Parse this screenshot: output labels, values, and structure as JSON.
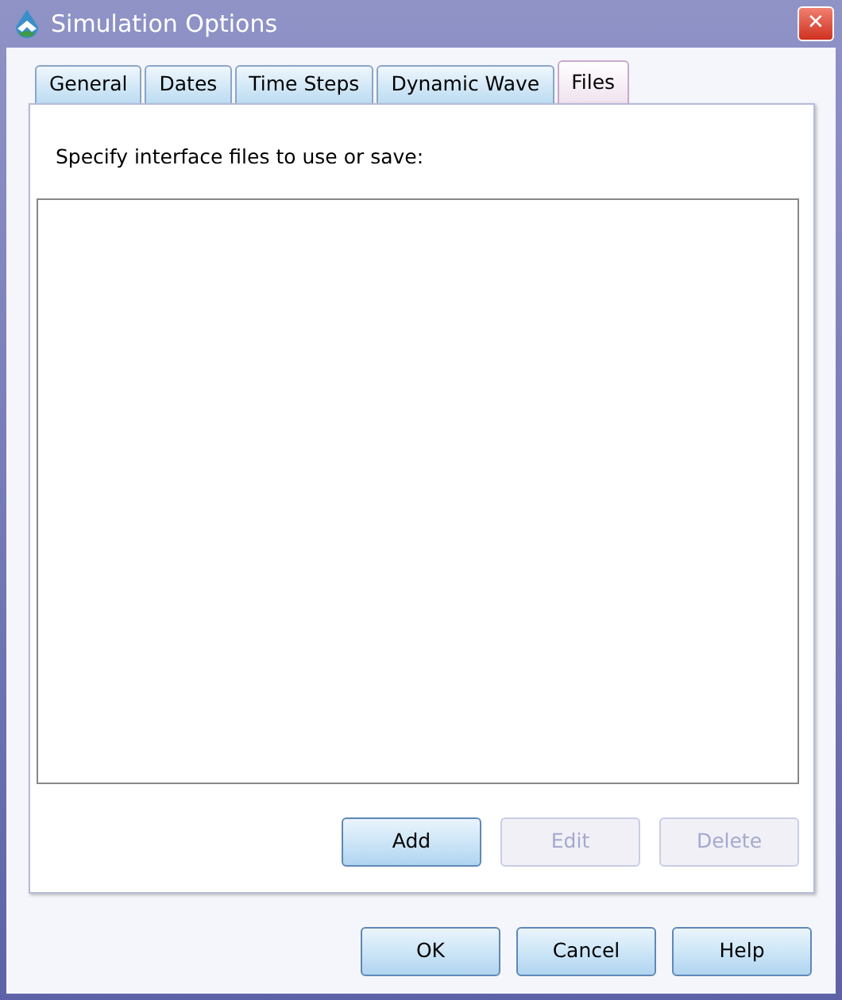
{
  "window": {
    "title": "Simulation Options",
    "close": "✕"
  },
  "tabs": [
    {
      "label": "General",
      "selected": false
    },
    {
      "label": "Dates",
      "selected": false
    },
    {
      "label": "Time Steps",
      "selected": false
    },
    {
      "label": "Dynamic Wave",
      "selected": false
    },
    {
      "label": "Files",
      "selected": true
    }
  ],
  "files_panel": {
    "prompt": "Specify interface files to use or save:",
    "buttons": [
      {
        "label": "Add",
        "disabled": false
      },
      {
        "label": "Edit",
        "disabled": true
      },
      {
        "label": "Delete",
        "disabled": true
      }
    ]
  },
  "buttons": [
    {
      "label": "OK",
      "disabled": false
    },
    {
      "label": "Cancel",
      "disabled": false
    },
    {
      "label": "Help",
      "disabled": false
    }
  ]
}
